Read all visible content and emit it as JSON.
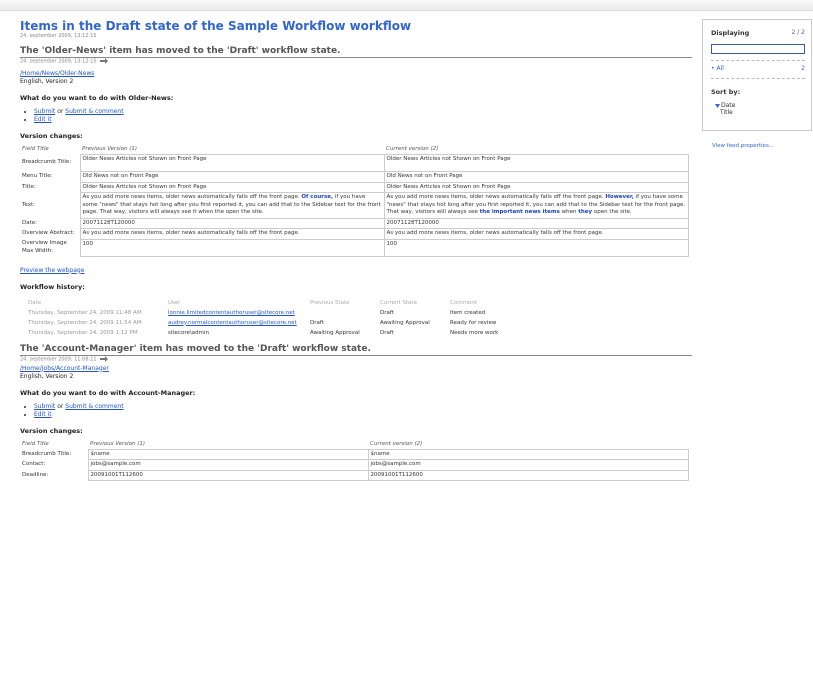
{
  "feed": {
    "title": "Items in the Draft state of the Sample Workflow workflow",
    "date": "24. september 2009, 13:12:15"
  },
  "items": [
    {
      "title": "The 'Older-News' item has moved to the 'Draft' workflow state.",
      "date": "24. september 2009, 13:12:15",
      "path": "/Home/News/Older-News",
      "language_version": "English, Version 2",
      "question": "What do you want to do with Older-News:",
      "submit_label": "Submit",
      "or_label": "or",
      "submit_comment_label": "Submit & comment",
      "edit_label": "Edit it",
      "version_changes_label": "Version changes:",
      "col_field": "Field Title",
      "col_prev": "Previous Version (1)",
      "col_curr": "Current version (2)",
      "rows": [
        {
          "field": "Breadcrumb Title:",
          "prev": "Older News Articles not Shown on Front Page",
          "curr": "Older News Articles not Shown on Front Page"
        },
        {
          "field": "Menu Title:",
          "prev": "Old News not on Front Page",
          "curr": "Old News not on Front Page"
        },
        {
          "field": "Title:",
          "prev": "Older News Articles not Shown on Front Page",
          "curr": "Older News Articles not Shown on Front Page"
        },
        {
          "field": "Text:",
          "prev_a": "As you add more news items, older news automatically falls off the front page.",
          "prev_hl": "Of course,",
          "prev_b": "if you have some \"news\" that stays hot long after you first reported it, you can add that to the Sidebar text for the front page. That way, visitors will always see it when the open the site.",
          "curr_a": "As you add more news items, older news automatically falls off the front page.",
          "curr_hl": "However,",
          "curr_b": "if you have some \"news\" that stays hot long after you first reported it, you can add that to the Sidebar text for the front page. That way, visitors will always see",
          "curr_hl2": "the important news items",
          "curr_c": "when",
          "curr_hl3": "they",
          "curr_d": "open the site."
        },
        {
          "field": "Date:",
          "prev": "20071128T120000",
          "curr": "20071128T120000"
        },
        {
          "field": "Overview Abstract:",
          "prev": "As you add more news items, older news automatically falls off the front page.",
          "curr": "As you add more news items, older news automatically falls off the front page."
        },
        {
          "field": "Overview Image Max Width:",
          "prev": "100",
          "curr": "100"
        }
      ],
      "preview_label": "Preview the webpage",
      "workflow_history_label": "Workflow history:",
      "history_headers": [
        "Date",
        "User",
        "Previous State",
        "Current State",
        "Comment"
      ],
      "history": [
        {
          "date": "Thursday, September 24, 2009 11:48 AM",
          "user": "lonnie.limitedcontentauthoruser@sitecore.net",
          "prev": "",
          "curr": "Draft",
          "comment": "Item created"
        },
        {
          "date": "Thursday, September 24, 2009 11:54 AM",
          "user": "audrey.normalcontentauthoruser@sitecore.net",
          "prev": "Draft",
          "curr": "Awaiting Approval",
          "comment": "Ready for review"
        },
        {
          "date": "Thursday, September 24, 2009 1:12 PM",
          "user": "sitecore\\admin",
          "prev": "Awaiting Approval",
          "curr": "Draft",
          "comment": "Needs more work"
        }
      ]
    },
    {
      "title": "The 'Account-Manager' item has moved to the 'Draft' workflow state.",
      "date": "24. september 2009, 11:08:11",
      "path": "/Home/Jobs/Account-Manager",
      "language_version": "English, Version 2",
      "question": "What do you want to do with Account-Manager:",
      "submit_label": "Submit",
      "or_label": "or",
      "submit_comment_label": "Submit & comment",
      "edit_label": "Edit it",
      "version_changes_label": "Version changes:",
      "col_field": "Field Title",
      "col_prev": "Previous Version (1)",
      "col_curr": "Current version (2)",
      "rows": [
        {
          "field": "Breadcrumb Title:",
          "prev": "$name",
          "curr": "$name"
        },
        {
          "field": "Contact:",
          "prev": "jobs@sample.com",
          "curr": "jobs@sample.com"
        },
        {
          "field": "Deadline:",
          "prev": "20091001T112600",
          "curr": "20091001T112600"
        }
      ]
    }
  ],
  "sidebar": {
    "displaying_label": "Displaying",
    "displaying_count": "2 / 2",
    "search_value": "",
    "all_label": "All",
    "all_count": "2",
    "sort_by_label": "Sort by:",
    "sort_options": [
      "Date",
      "Title"
    ],
    "view_feed_properties": "View feed properties..."
  }
}
